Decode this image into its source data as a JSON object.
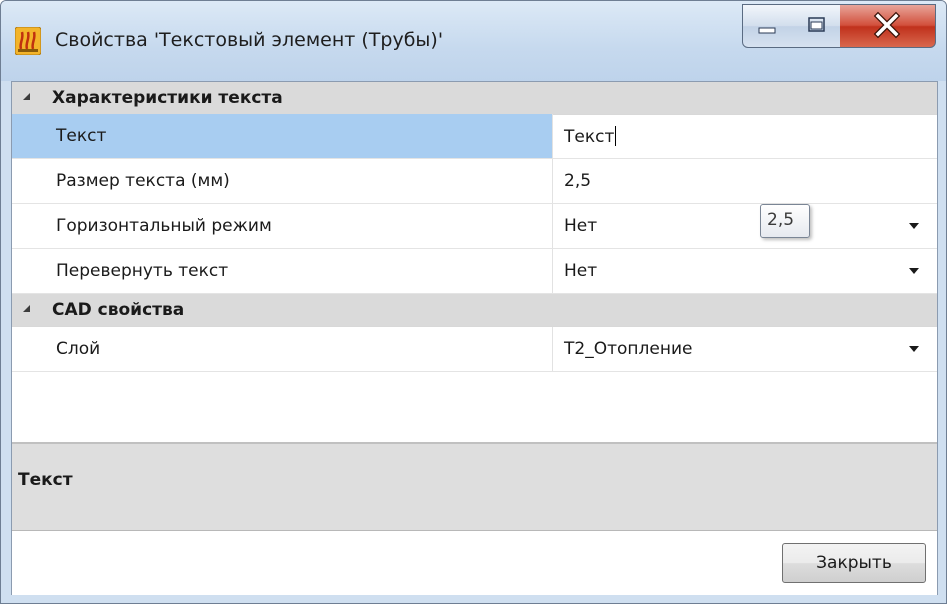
{
  "window": {
    "title": "Свойства 'Текстовый элемент (Трубы)'",
    "icon": "app-logo-icon",
    "controls": {
      "minimize": "minimize-icon",
      "maximize": "maximize-icon",
      "close": "close-icon"
    }
  },
  "property_grid": {
    "categories": [
      {
        "label": "Характеристики текста",
        "properties": [
          {
            "name": "Текст",
            "value": "Текст"
          },
          {
            "name": "Размер текста (мм)",
            "value": "2,5"
          },
          {
            "name": "Горизонтальный режим",
            "value": "Нет"
          },
          {
            "name": "Перевернуть текст",
            "value": "Нет"
          }
        ]
      },
      {
        "label": "CAD свойства",
        "properties": [
          {
            "name": "Слой",
            "value": "Т2_Отопление"
          }
        ]
      }
    ],
    "tooltip": "2,5"
  },
  "description": {
    "title": "Текст"
  },
  "footer": {
    "close_label": "Закрыть"
  },
  "colors": {
    "selection": "#a8cdf1",
    "category_bg": "#dadada",
    "close_button_red": "#c0311c",
    "title_bar": "#c6d9ee"
  }
}
